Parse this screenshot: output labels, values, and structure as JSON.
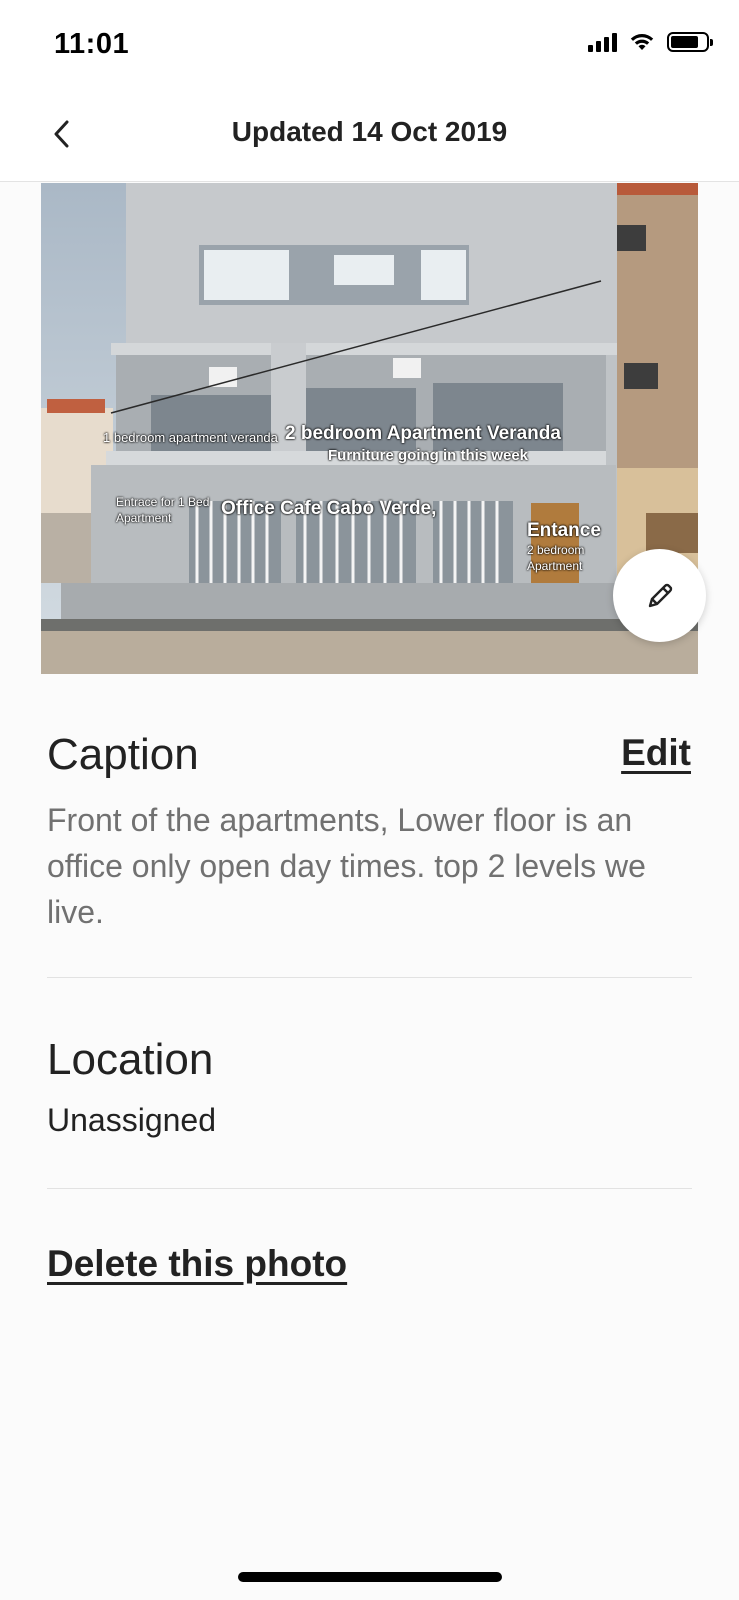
{
  "status_bar": {
    "time": "11:01"
  },
  "header": {
    "title": "Updated 14 Oct 2019"
  },
  "photo": {
    "overlay_labels": {
      "one_bed_veranda": "1 bedroom apartment veranda",
      "two_bed_veranda": "2 bedroom Apartment Veranda",
      "furniture": "Furniture going in this week",
      "entrace_one_bed_line1": "Entrace for 1 Bed",
      "entrace_one_bed_line2": "Apartment",
      "office_cafe": "Office Cafe Cabo Verde,",
      "entance": "Entance",
      "entance_sub_line1": "2 bedroom",
      "entance_sub_line2": "Apartment"
    }
  },
  "caption": {
    "title": "Caption",
    "edit_label": "Edit",
    "text": "Front of the apartments, Lower floor is an office only open day times. top 2 levels we live."
  },
  "location": {
    "title": "Location",
    "value": "Unassigned"
  },
  "actions": {
    "delete_label": "Delete this photo"
  }
}
